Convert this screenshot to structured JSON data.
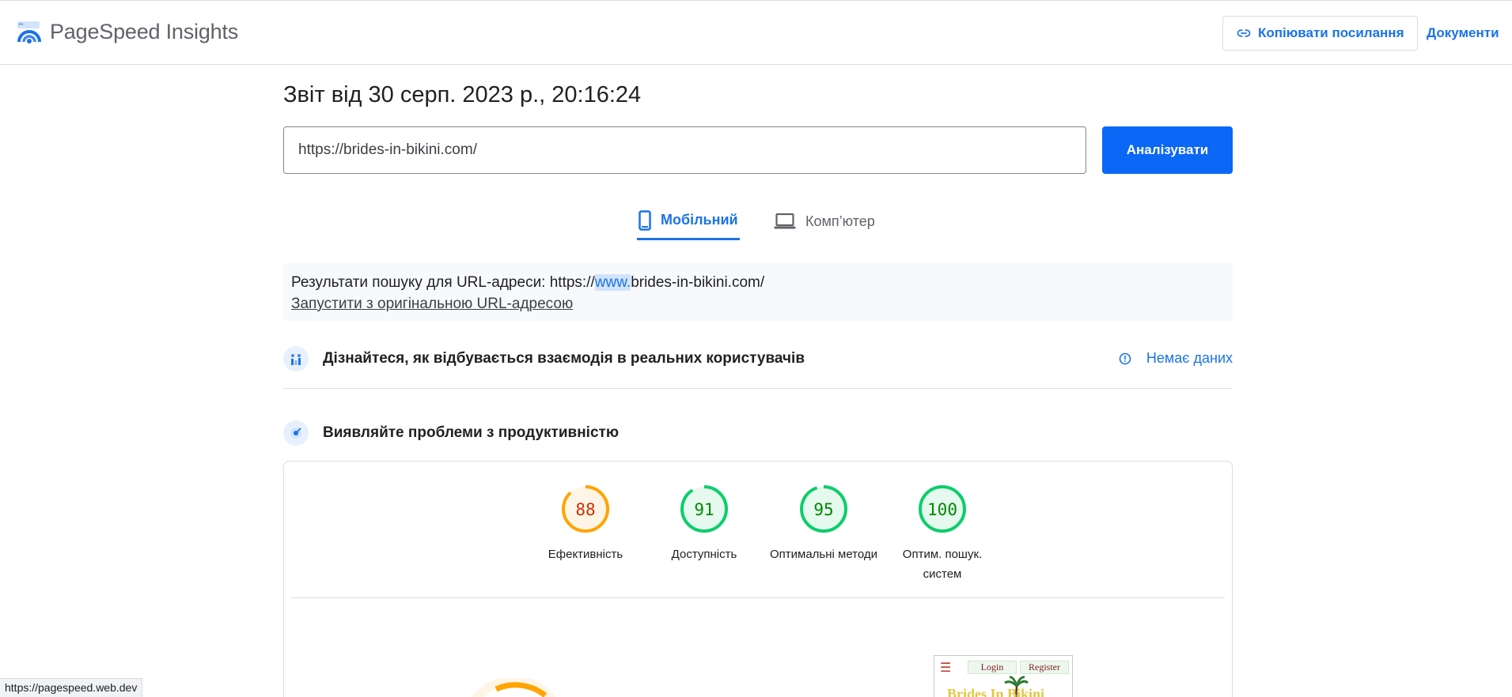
{
  "header": {
    "brand": "PageSpeed Insights",
    "copy_link_label": "Копіювати посилання",
    "docs_label": "Документи"
  },
  "report": {
    "title": "Звіт від 30 серп. 2023 р., 20:16:24",
    "url_value": "https://brides-in-bikini.com/",
    "analyze_label": "Аналізувати"
  },
  "tabs": [
    {
      "label": "Мобільний",
      "icon": "smartphone-icon",
      "active": true
    },
    {
      "label": "Комп’ютер",
      "icon": "laptop-icon",
      "active": false
    }
  ],
  "notice": {
    "prefix": "Результати пошуку для URL-адреси: https://",
    "highlight": "www.",
    "suffix": "brides-in-bikini.com/",
    "link_label": "Запустити з оригінальною URL-адресою"
  },
  "crux": {
    "title": "Дізнайтеся, як відбувається взаємодія в реальних користувачів",
    "status": "Немає даних"
  },
  "performance": {
    "title": "Виявляйте проблеми з продуктивністю"
  },
  "scores": [
    {
      "value": "88",
      "label": "Ефективність",
      "level": "average"
    },
    {
      "value": "91",
      "label": "Доступність",
      "level": "pass"
    },
    {
      "value": "95",
      "label": "Оптимальні методи",
      "level": "pass"
    },
    {
      "value": "100",
      "label": "Оптим. пошук. систем",
      "level": "pass"
    }
  ],
  "colors": {
    "accent": "#1a73e8",
    "analyze_button": "#0b67f6",
    "pass_stroke": "#0cce6b",
    "pass_fill": "#e6f9ee",
    "pass_text": "#008800",
    "average_stroke": "#ffa400",
    "average_fill": "#fff5e6",
    "average_text": "#c33300"
  },
  "thumbnail": {
    "login": "Login",
    "register": "Register",
    "site_title": "Brides In Bikini"
  },
  "statusbar": {
    "url": "https://pagespeed.web.dev"
  }
}
